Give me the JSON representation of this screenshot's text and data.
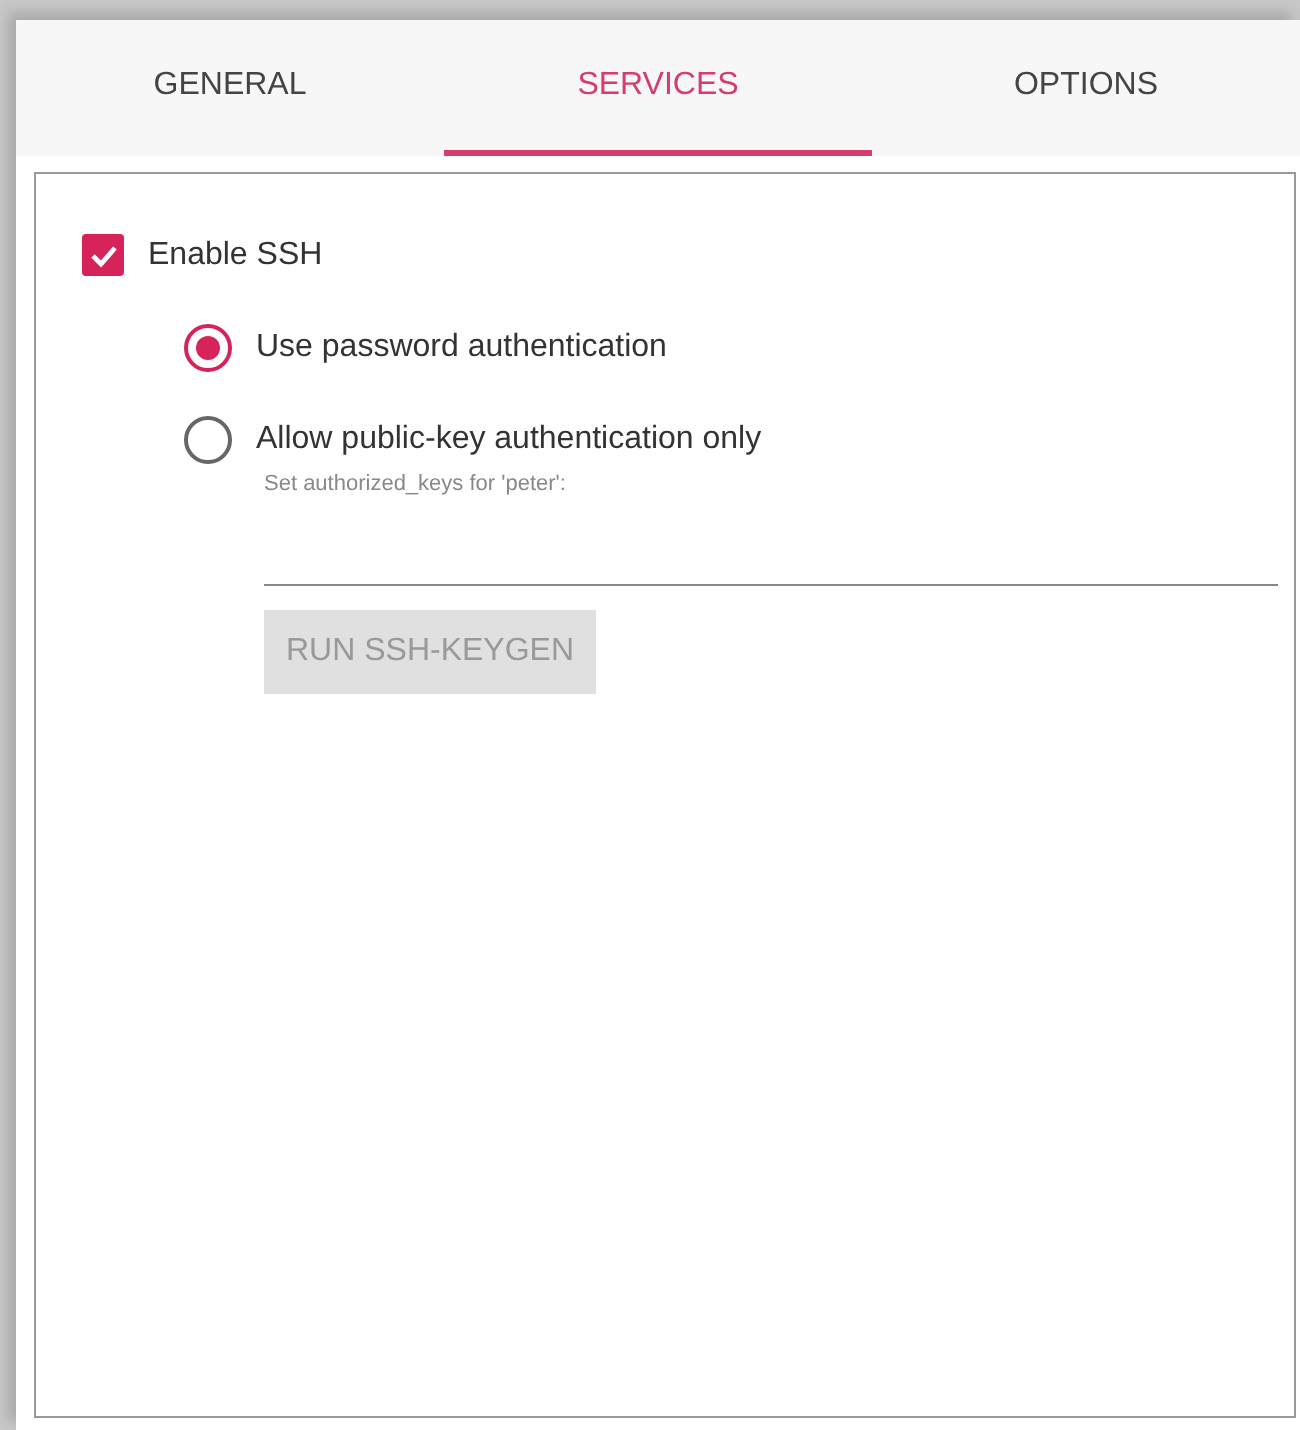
{
  "tabs": [
    {
      "label": "GENERAL",
      "selected": false
    },
    {
      "label": "SERVICES",
      "selected": true
    },
    {
      "label": "OPTIONS",
      "selected": false
    }
  ],
  "ssh": {
    "label": "Enable SSH",
    "checked": true
  },
  "auth_options": [
    {
      "label": "Use password authentication",
      "selected": true
    },
    {
      "label": "Allow public-key authentication only",
      "selected": false
    }
  ],
  "keys_field": {
    "label": "Set authorized_keys for 'peter':",
    "disabled": true
  },
  "keygen_button": {
    "label": "RUN SSH-KEYGEN",
    "disabled": true
  }
}
